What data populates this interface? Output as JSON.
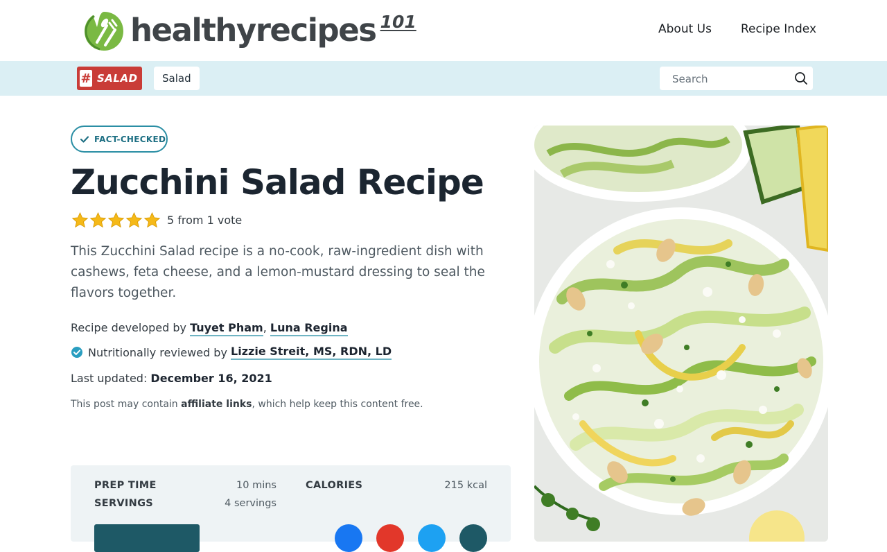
{
  "header": {
    "logo_text": "healthyrecipes",
    "logo_suffix": "101",
    "nav": [
      "About Us",
      "Recipe Index"
    ]
  },
  "category_bar": {
    "tag_hash": "#",
    "tag_label": "SALAD",
    "chip_label": "Salad",
    "search_placeholder": "Search"
  },
  "article": {
    "badge": "FACT-CHECKED",
    "title": "Zucchini Salad Recipe",
    "rating_text": "5 from 1 vote",
    "rating_value": 5,
    "rating_max": 5,
    "intro": "This Zucchini Salad recipe is a no-cook, raw-ingredient dish with cashews, feta cheese, and a lemon-mustard dressing to seal the flavors together.",
    "developed_prefix": "Recipe developed by ",
    "developer_1": "Tuyet Pham",
    "developer_sep": ", ",
    "developer_2": "Luna Regina",
    "reviewed_prefix": "Nutritionally reviewed by ",
    "reviewer": "Lizzie Streit, MS, RDN, LD",
    "updated_prefix": "Last updated: ",
    "updated_date": "December 16, 2021",
    "affiliate_before": "This post may contain ",
    "affiliate_link": "affiliate links",
    "affiliate_after": ", which help keep this content free."
  },
  "recipe_info": {
    "prep_label": "PREP TIME",
    "prep_value": "10 mins",
    "servings_label": "SERVINGS",
    "servings_value": "4 servings",
    "calories_label": "CALORIES",
    "calories_value": "215 kcal"
  },
  "colors": {
    "brand_green": "#7ab943",
    "accent_teal": "#2a8ea4",
    "tag_red": "#c93c37",
    "star_yellow": "#f5b918"
  },
  "share_buttons": [
    {
      "name": "facebook-share-button",
      "color": "#1877f2"
    },
    {
      "name": "pinterest-share-button",
      "color": "#e2372a"
    },
    {
      "name": "twitter-share-button",
      "color": "#1da1f2"
    },
    {
      "name": "email-share-button",
      "color": "#1e5966"
    }
  ]
}
